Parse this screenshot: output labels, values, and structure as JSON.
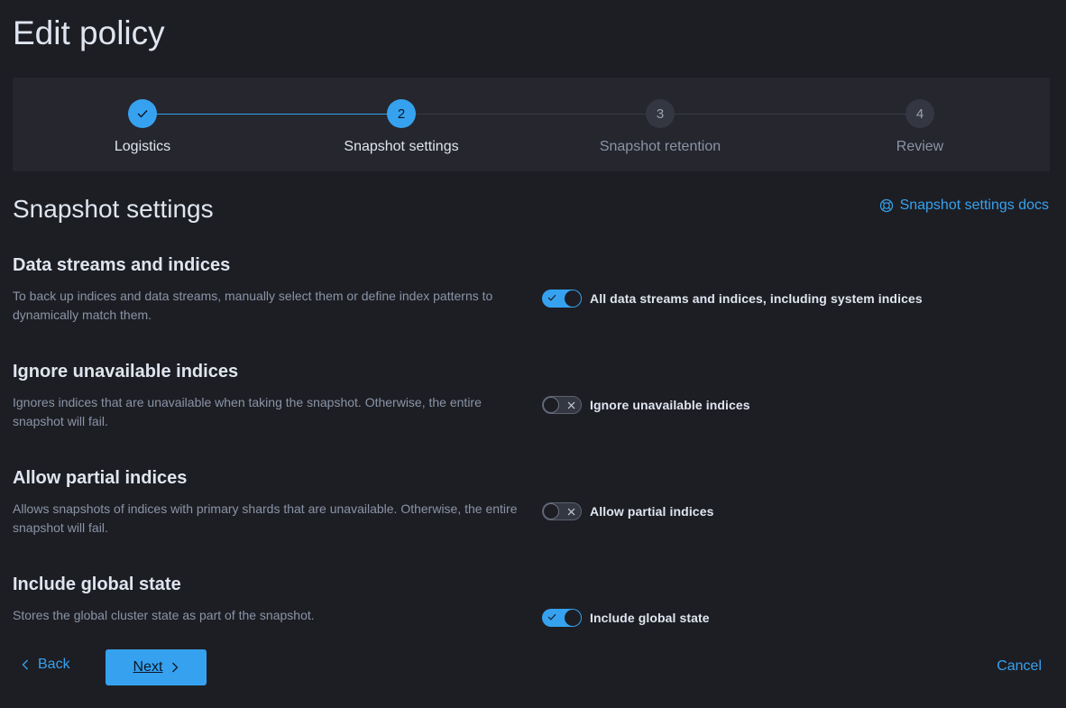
{
  "page": {
    "title": "Edit policy"
  },
  "stepper": {
    "steps": [
      {
        "number": "1",
        "label": "Logistics",
        "status": "complete",
        "icon": "check-icon"
      },
      {
        "number": "2",
        "label": "Snapshot settings",
        "status": "current"
      },
      {
        "number": "3",
        "label": "Snapshot retention",
        "status": "incomplete"
      },
      {
        "number": "4",
        "label": "Review",
        "status": "incomplete"
      }
    ]
  },
  "section": {
    "title": "Snapshot settings",
    "docs_link": {
      "label": "Snapshot settings docs",
      "icon": "lifebuoy-icon"
    }
  },
  "settings": [
    {
      "title": "Data streams and indices",
      "description": "To back up indices and data streams, manually select them or define index patterns to dynamically match them.",
      "toggle_label": "All data streams and indices, including system indices",
      "enabled": true
    },
    {
      "title": "Ignore unavailable indices",
      "description": "Ignores indices that are unavailable when taking the snapshot. Otherwise, the entire snapshot will fail.",
      "toggle_label": "Ignore unavailable indices",
      "enabled": false
    },
    {
      "title": "Allow partial indices",
      "description": "Allows snapshots of indices with primary shards that are unavailable. Otherwise, the entire snapshot will fail.",
      "toggle_label": "Allow partial indices",
      "enabled": false
    },
    {
      "title": "Include global state",
      "description": "Stores the global cluster state as part of the snapshot.",
      "toggle_label": "Include global state",
      "enabled": true
    }
  ],
  "footer": {
    "back_label": "Back",
    "next_label": "Next",
    "cancel_label": "Cancel"
  },
  "colors": {
    "accent": "#36a2ef",
    "background": "#1d1e24",
    "panel": "#25262e"
  }
}
